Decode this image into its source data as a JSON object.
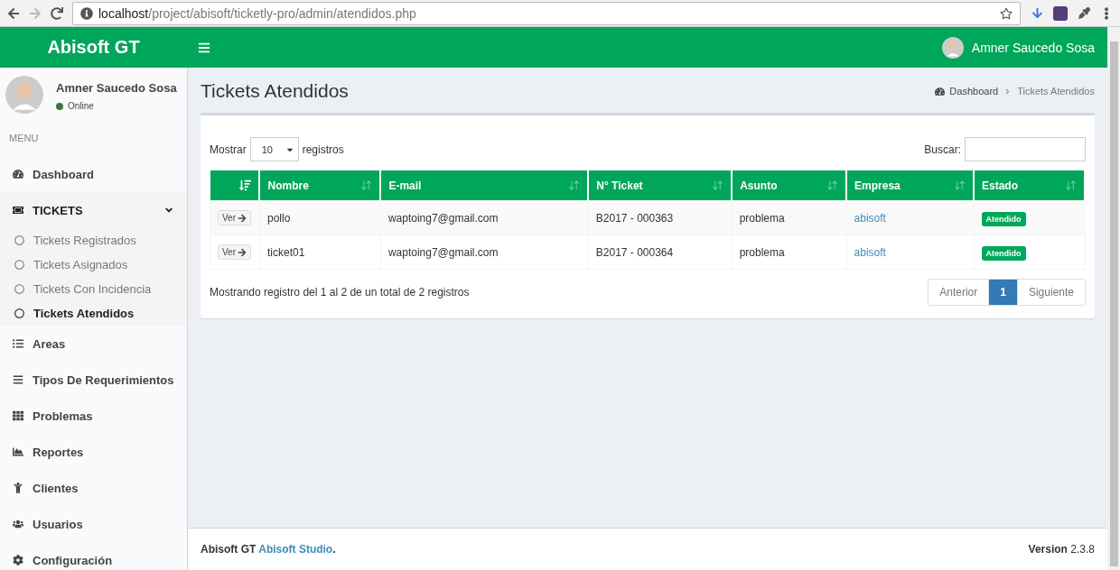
{
  "browser": {
    "url_host": "localhost",
    "url_path": "/project/abisoft/ticketly-pro/admin/atendidos.php",
    "forward_disabled": true
  },
  "header": {
    "brand": "Abisoft GT",
    "user": "Amner Saucedo Sosa"
  },
  "sidebar": {
    "user": {
      "name": "Amner Saucedo Sosa",
      "status": "Online",
      "color": "#3c763d"
    },
    "menu_label": "MENU",
    "items": [
      {
        "label": "Dashboard",
        "selected": false
      },
      {
        "label": "TICKETS",
        "selected": true,
        "expanded": true,
        "children": [
          {
            "label": "Tickets Registrados",
            "selected": false
          },
          {
            "label": "Tickets Asignados",
            "selected": false
          },
          {
            "label": "Tickets Con Incidencia",
            "selected": false
          },
          {
            "label": "Tickets Atendidos",
            "selected": true
          }
        ]
      },
      {
        "label": "Areas",
        "selected": false
      },
      {
        "label": "Tipos De Requerimientos",
        "selected": false
      },
      {
        "label": "Problemas",
        "selected": false
      },
      {
        "label": "Reportes",
        "selected": false
      },
      {
        "label": "Clientes",
        "selected": false
      },
      {
        "label": "Usuarios",
        "selected": false
      },
      {
        "label": "Configuración",
        "selected": false
      }
    ]
  },
  "content": {
    "title": "Tickets Atendidos",
    "breadcrumb": [
      "Dashboard",
      "Tickets Atendidos"
    ],
    "length": {
      "before": "Mostrar",
      "value": "10",
      "after": "registros"
    },
    "search_label": "Buscar:",
    "table": {
      "columns": [
        {
          "sorted": true
        },
        {
          "label": "Nombre",
          "sorted": false
        },
        {
          "label": "E-mail",
          "sorted": false
        },
        {
          "label": "N° Ticket",
          "sorted": false
        },
        {
          "label": "Asunto",
          "sorted": false
        },
        {
          "label": "Empresa",
          "sorted": false
        },
        {
          "label": "Estado",
          "sorted": false
        }
      ],
      "rows": [
        {
          "action": "Ver",
          "nombre": "pollo",
          "email": "waptoing7@gmail.com",
          "ticket": "B2017 - 000363",
          "asunto": "problema",
          "empresa": "abisoft",
          "estado": "Atendido"
        },
        {
          "action": "Ver",
          "nombre": "ticket01",
          "email": "waptoing7@gmail.com",
          "ticket": "B2017 - 000364",
          "asunto": "problema",
          "empresa": "abisoft",
          "estado": "Atendido"
        }
      ]
    },
    "info": "Mostrando registro del 1 al 2 de un total de 2 registros",
    "pagination": [
      {
        "label": "Anterior",
        "selected": false
      },
      {
        "label": "1",
        "selected": true
      },
      {
        "label": "Siguiente",
        "selected": false
      }
    ]
  },
  "footer": {
    "brand": "Abisoft GT",
    "link": "Abisoft Studio",
    "suffix": ".",
    "version_label": "Version",
    "version": "2.3.8"
  }
}
